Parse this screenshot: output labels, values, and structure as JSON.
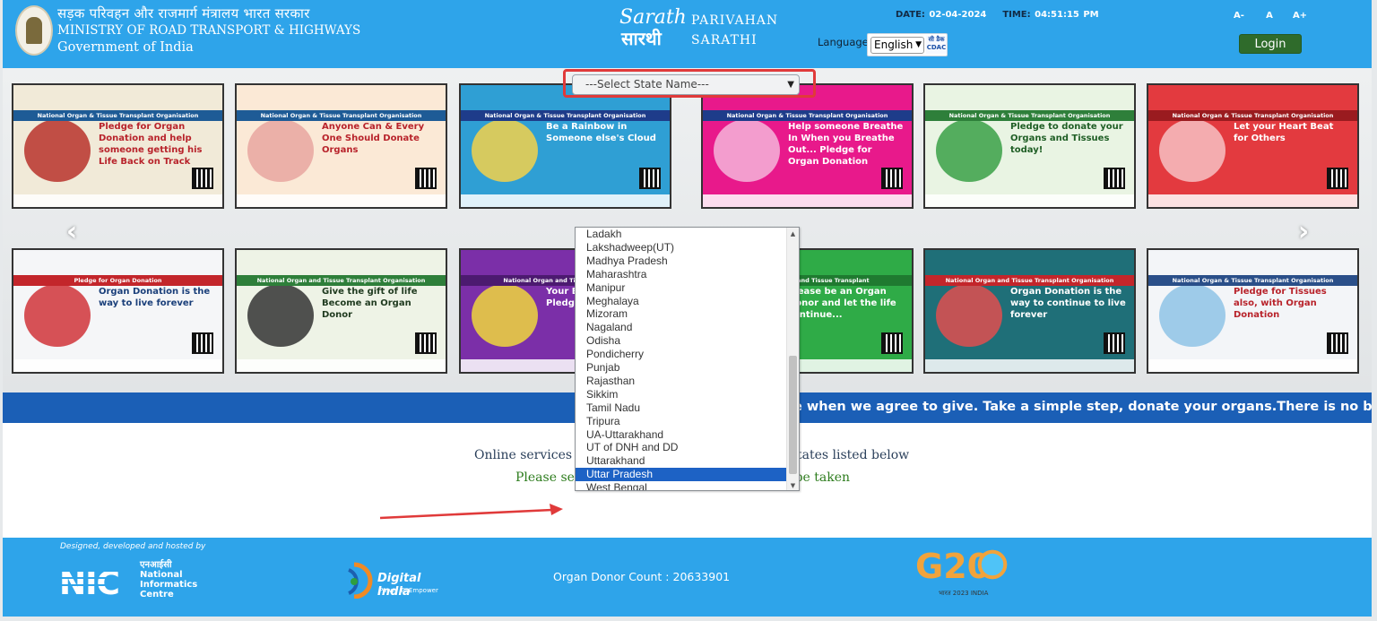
{
  "header": {
    "ministry_hindi": "सड़क परिवहन और राजमार्ग मंत्रालय भारत सरकार",
    "ministry_english": "MINISTRY OF ROAD TRANSPORT & HIGHWAYS",
    "government": "Government of India",
    "logo_text": "Sarathi सारथी",
    "brand_line1": "PARIVAHAN",
    "brand_line2": "SARATHI",
    "date_label": "DATE:",
    "date_value": "02-04-2024",
    "time_label": "TIME:",
    "time_value": "04:51:15 PM",
    "language_label": "Language",
    "language_value": "English",
    "cdac_text": "सी डैक CDAC",
    "font_small": "A-",
    "font_normal": "A",
    "font_large": "A+",
    "login_label": "Login",
    "colors": {
      "header_bg": "#2ea4ea",
      "login_bg": "#2f6b2b"
    }
  },
  "carousel": {
    "prev_icon": "chevron-left-icon",
    "next_icon": "chevron-right-icon",
    "banners": [
      {
        "band": "National Organ & Tissue Transplant Organisation",
        "headline": "Pledge for Organ Donation and help someone getting his Life Back on Track"
      },
      {
        "band": "National Organ & Tissue Transplant Organisation",
        "headline": "Anyone Can & Every One Should Donate Organs"
      },
      {
        "band": "National Organ & Tissue Transplant Organisation",
        "headline": "Be a Rainbow in Someone else's Cloud"
      },
      {
        "band": "National Organ & Tissue Transplant Organisation",
        "headline": "Help someone Breathe In When you Breathe Out... Pledge for Organ Donation"
      },
      {
        "band": "National Organ & Tissue Transplant Organisation",
        "headline": "Pledge to donate your Organs and Tissues today!"
      },
      {
        "band": "National Organ & Tissue Transplant Organisation",
        "headline": "Let your Heart Beat for Others"
      },
      {
        "band": "Pledge for Organ Donation",
        "headline": "Organ Donation is the way to live forever"
      },
      {
        "band": "National Organ and Tissue Transplant Organisation",
        "headline": "Give the gift of life Become an Organ Donor"
      },
      {
        "band": "National Organ and Tissue Transplant",
        "headline": "Your Eyes have more... Pledge for Organ"
      },
      {
        "band": "National Organ and Tissue Transplant",
        "headline": "Please be an Organ Donor and let the life continue..."
      },
      {
        "band": "National Organ and Tissue Transplant Organisation",
        "headline": "Organ Donation is the way to continue to live forever"
      },
      {
        "band": "National Organ & Tissue Transplant Organisation",
        "headline": "Pledge for Tissues also, with Organ Donation"
      }
    ]
  },
  "ticker": {
    "text": "e when we agree to give. Take a simple step, donate your organs.There is no bar of age sex and c"
  },
  "main": {
    "line1_left": "Online services i",
    "line1_right": "tates listed below",
    "line2_left": "Please sele",
    "line2_right": "o be taken",
    "state_select_value": "---Select State Name---",
    "state_options": [
      "Ladakh",
      "Lakshadweep(UT)",
      "Madhya Pradesh",
      "Maharashtra",
      "Manipur",
      "Meghalaya",
      "Mizoram",
      "Nagaland",
      "Odisha",
      "Pondicherry",
      "Punjab",
      "Rajasthan",
      "Sikkim",
      "Tamil Nadu",
      "Tripura",
      "UA-Uttarakhand",
      "UT of DNH and DD",
      "Uttarakhand",
      "Uttar Pradesh",
      "West Bengal"
    ],
    "selected_option_index": 18,
    "highlight_color": "#e03a3a"
  },
  "footer": {
    "designed_by": "Designed, developed and hosted by",
    "nic_hindi": "एनआईसी",
    "nic_line1": "National",
    "nic_line2": "Informatics",
    "nic_line3": "Centre",
    "digital_india": "Digital India",
    "digital_india_tag": "Power To Empower",
    "donor_count_label": "Organ Donor Count :",
    "donor_count_value": "20633901",
    "g20_text": "G20",
    "g20_sub": "भारत 2023 INDIA"
  }
}
